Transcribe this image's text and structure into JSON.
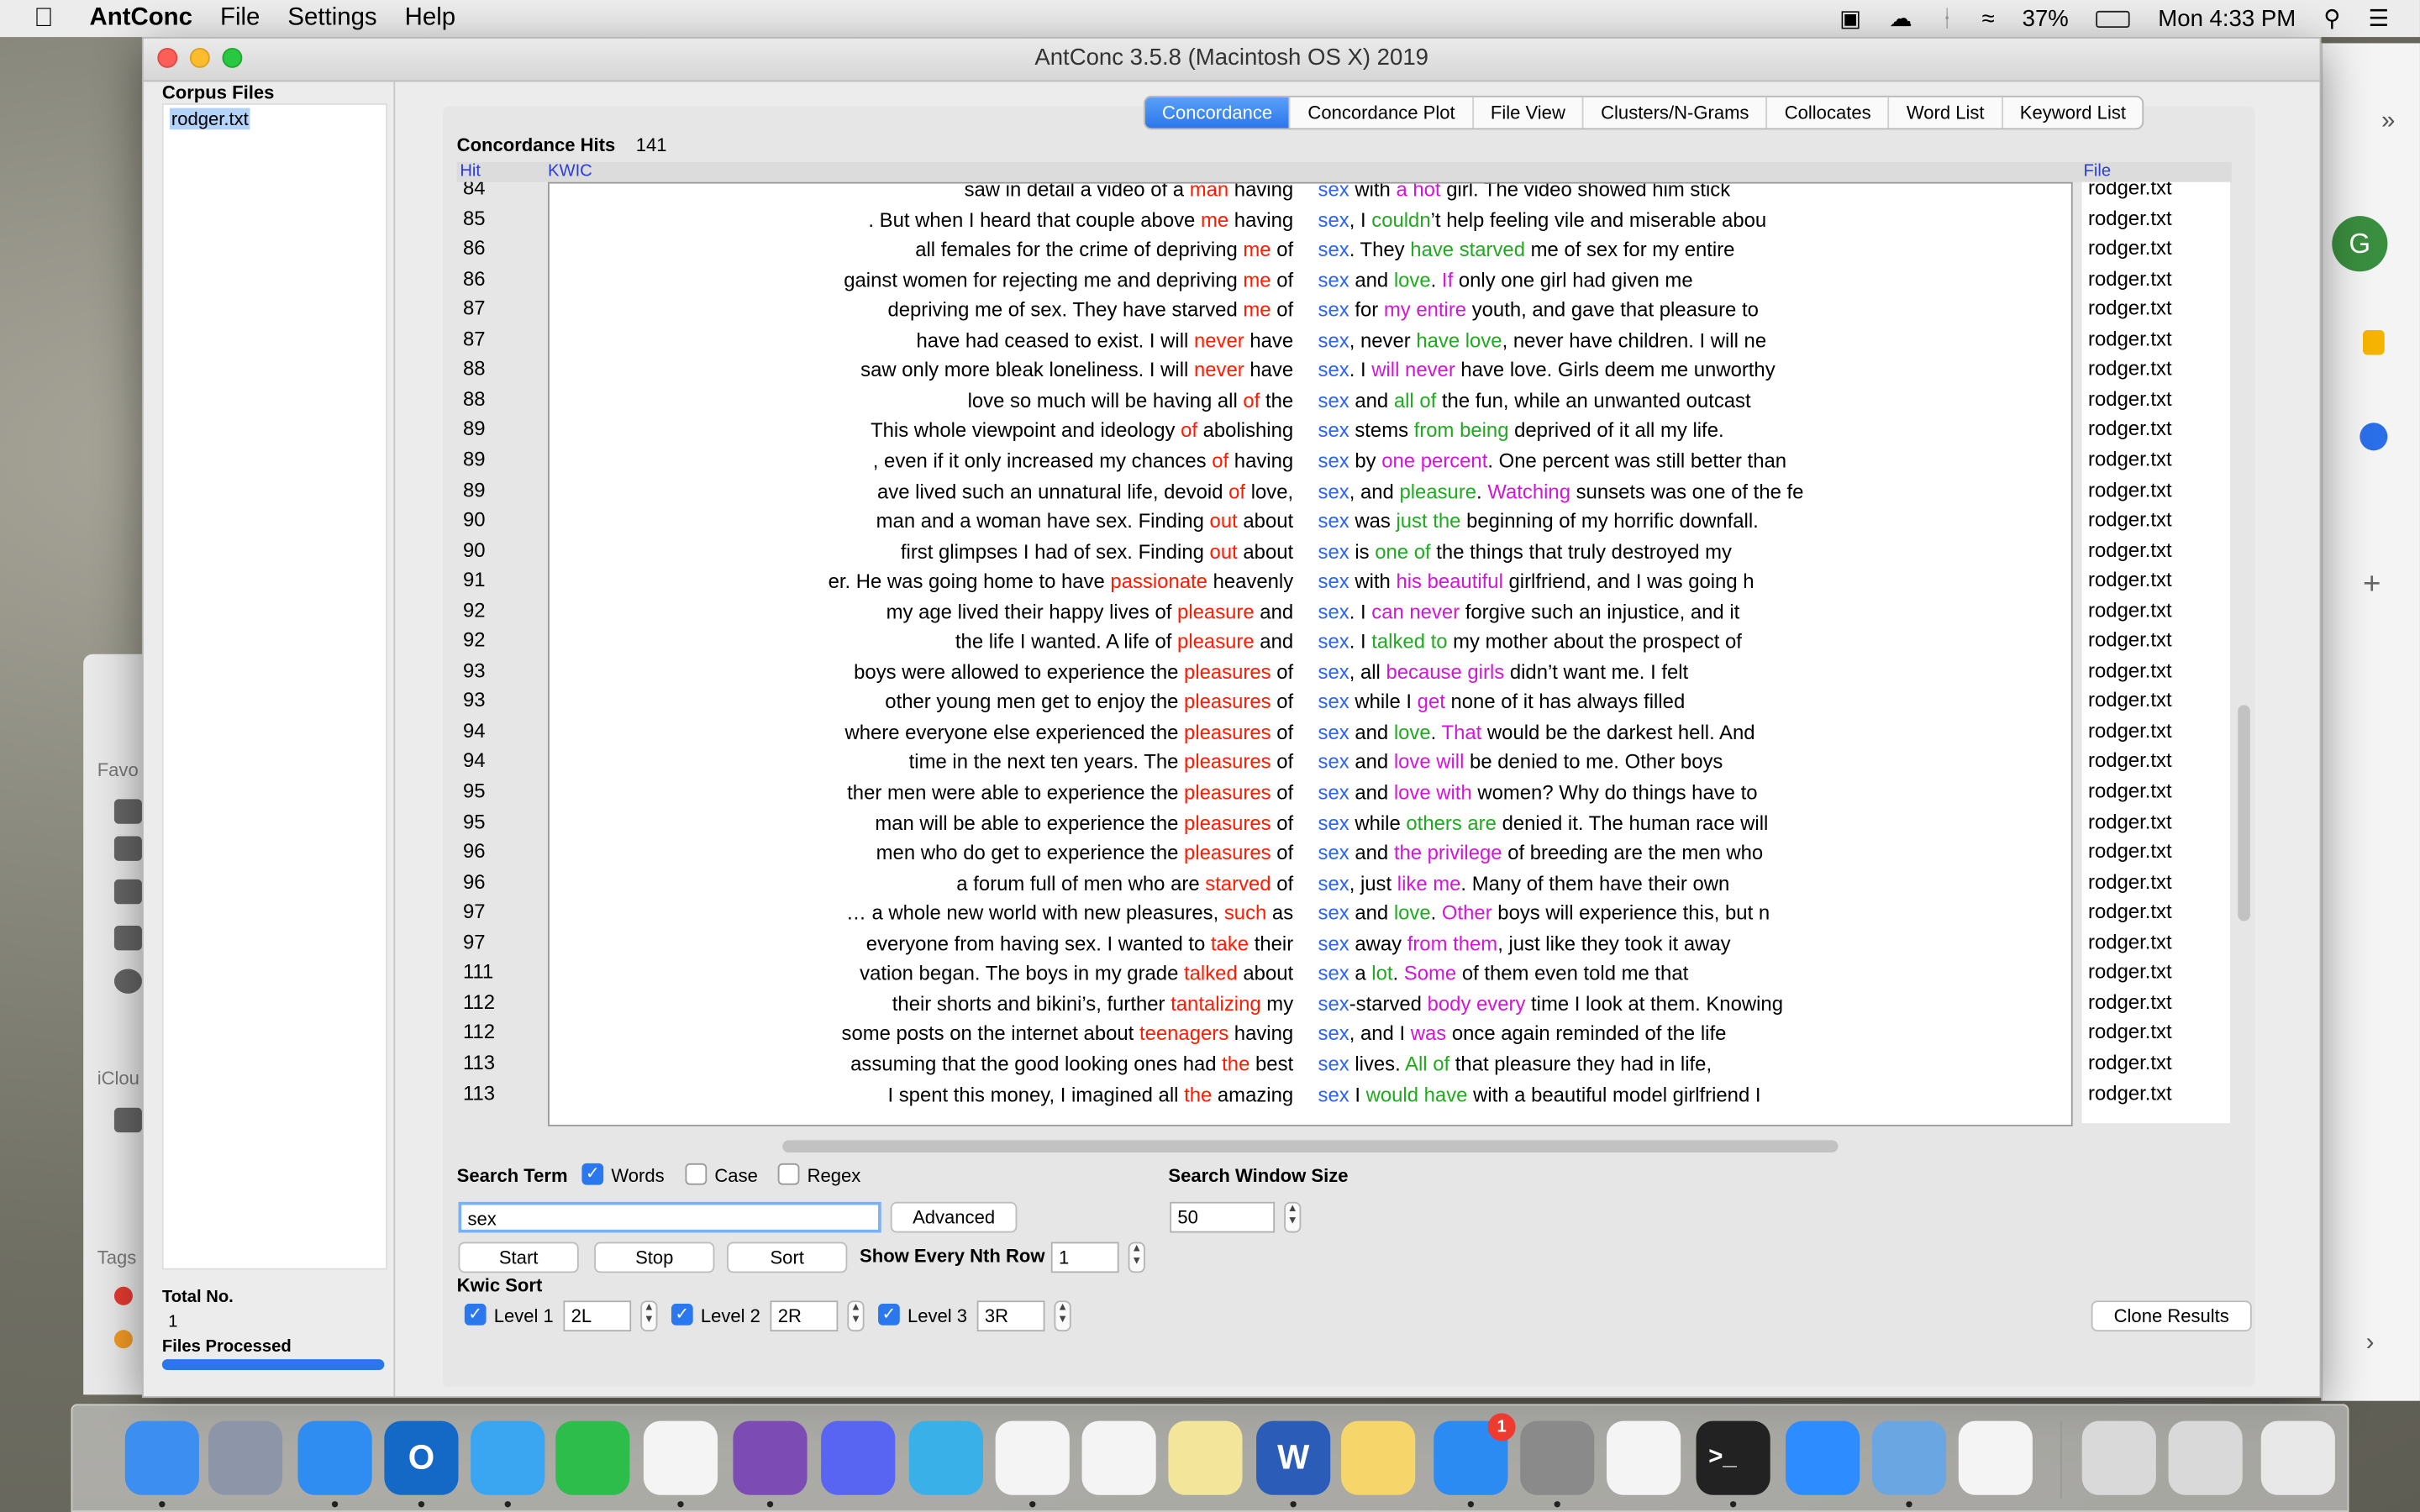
{
  "menubar": {
    "app": "AntConc",
    "menus": [
      "File",
      "Settings",
      "Help"
    ],
    "battery": "37%",
    "clock": "Mon 4:33 PM"
  },
  "window": {
    "title": "AntConc 3.5.8 (Macintosh OS X) 2019"
  },
  "corpus": {
    "header": "Corpus Files",
    "files": [
      "rodger.txt"
    ],
    "total_label": "Total No.",
    "total_value": "1",
    "processed_label": "Files Processed"
  },
  "tabs": [
    "Concordance",
    "Concordance Plot",
    "File View",
    "Clusters/N-Grams",
    "Collocates",
    "Word List",
    "Keyword List"
  ],
  "hits": {
    "label": "Concordance Hits",
    "value": "141"
  },
  "columns": {
    "hit": "Hit",
    "kwic": "KWIC",
    "file": "File"
  },
  "rows": [
    {
      "hit": "84",
      "file": "rodger.txt",
      "l": [
        [
          "saw in  detail a video of a ",
          ""
        ],
        [
          "man",
          "r"
        ],
        [
          " having",
          ""
        ]
      ],
      "r": [
        [
          "sex",
          "kw"
        ],
        [
          " with ",
          ""
        ],
        [
          "a hot",
          "m"
        ],
        [
          " girl. The video showed him stick",
          ""
        ]
      ]
    },
    {
      "hit": "85",
      "file": "rodger.txt",
      "l": [
        [
          ". But when I heard that couple above ",
          ""
        ],
        [
          "me",
          "r"
        ],
        [
          " having",
          ""
        ]
      ],
      "r": [
        [
          "sex",
          "kw"
        ],
        [
          ", I ",
          ""
        ],
        [
          "couldn",
          "g"
        ],
        [
          "’t help feeling vile and  miserable abou",
          ""
        ]
      ]
    },
    {
      "hit": "86",
      "file": "rodger.txt",
      "l": [
        [
          "all females for the crime of depriving  ",
          ""
        ],
        [
          "me",
          "r"
        ],
        [
          " of",
          ""
        ]
      ],
      "r": [
        [
          "sex",
          "kw"
        ],
        [
          ". They ",
          ""
        ],
        [
          "have starved",
          "g"
        ],
        [
          " me of sex for my entire",
          ""
        ]
      ]
    },
    {
      "hit": "86",
      "file": "rodger.txt",
      "l": [
        [
          "gainst women for rejecting me and depriving ",
          ""
        ],
        [
          "me",
          "r"
        ],
        [
          " of",
          ""
        ]
      ],
      "r": [
        [
          "sex",
          "kw"
        ],
        [
          " and  ",
          ""
        ],
        [
          "love",
          "g"
        ],
        [
          ". ",
          ""
        ],
        [
          "If",
          "m"
        ],
        [
          " only one girl had given me",
          ""
        ]
      ]
    },
    {
      "hit": "87",
      "file": "rodger.txt",
      "l": [
        [
          "depriving  me of sex. They have starved ",
          ""
        ],
        [
          "me",
          "r"
        ],
        [
          " of",
          ""
        ]
      ],
      "r": [
        [
          "sex",
          "kw"
        ],
        [
          " for ",
          ""
        ],
        [
          "my entire",
          "m"
        ],
        [
          " youth, and gave that pleasure to",
          ""
        ]
      ]
    },
    {
      "hit": "87",
      "file": "rodger.txt",
      "l": [
        [
          "have had ceased to exist. I will ",
          ""
        ],
        [
          "never",
          "r"
        ],
        [
          " have",
          ""
        ]
      ],
      "r": [
        [
          "sex",
          "kw"
        ],
        [
          ", never ",
          ""
        ],
        [
          "have love",
          "g"
        ],
        [
          ", never have children. I  will ne",
          ""
        ]
      ]
    },
    {
      "hit": "88",
      "file": "rodger.txt",
      "l": [
        [
          "saw only more bleak loneliness. I will ",
          ""
        ],
        [
          "never",
          "r"
        ],
        [
          " have",
          ""
        ]
      ],
      "r": [
        [
          "sex",
          "kw"
        ],
        [
          ". I ",
          ""
        ],
        [
          "will never",
          "m"
        ],
        [
          " have love. Girls deem  me unworthy",
          ""
        ]
      ]
    },
    {
      "hit": "88",
      "file": "rodger.txt",
      "l": [
        [
          "love so much will be having all ",
          ""
        ],
        [
          "of",
          "r"
        ],
        [
          " the",
          ""
        ]
      ],
      "r": [
        [
          "sex",
          "kw"
        ],
        [
          " and  ",
          ""
        ],
        [
          "all of",
          "g"
        ],
        [
          " the fun, while an unwanted outcast",
          ""
        ]
      ]
    },
    {
      "hit": "89",
      "file": "rodger.txt",
      "l": [
        [
          "This whole viewpoint and  ideology ",
          ""
        ],
        [
          "of",
          "r"
        ],
        [
          " abolishing",
          ""
        ]
      ],
      "r": [
        [
          "sex",
          "kw"
        ],
        [
          " stems ",
          ""
        ],
        [
          "from being",
          "g"
        ],
        [
          " deprived of it all my life.",
          ""
        ]
      ]
    },
    {
      "hit": "89",
      "file": "rodger.txt",
      "l": [
        [
          ", even if it  only increased my chances ",
          ""
        ],
        [
          "of",
          "r"
        ],
        [
          " having",
          ""
        ]
      ],
      "r": [
        [
          "sex",
          "kw"
        ],
        [
          " by ",
          ""
        ],
        [
          "one percent",
          "m"
        ],
        [
          ". One percent was still better than",
          ""
        ]
      ]
    },
    {
      "hit": "89",
      "file": "rodger.txt",
      "l": [
        [
          "ave lived such an unnatural life, devoid ",
          ""
        ],
        [
          "of",
          "r"
        ],
        [
          " love,",
          ""
        ]
      ],
      "r": [
        [
          "sex",
          "kw"
        ],
        [
          ", and ",
          ""
        ],
        [
          "pleasure",
          "g"
        ],
        [
          ". ",
          ""
        ],
        [
          "Watching",
          "m"
        ],
        [
          " sunsets was one of the fe",
          ""
        ]
      ]
    },
    {
      "hit": "90",
      "file": "rodger.txt",
      "l": [
        [
          "man and a woman have sex. Finding ",
          ""
        ],
        [
          "out",
          "r"
        ],
        [
          " about",
          ""
        ]
      ],
      "r": [
        [
          "sex",
          "kw"
        ],
        [
          " was ",
          ""
        ],
        [
          "just the",
          "g"
        ],
        [
          "  beginning of my horrific downfall.",
          ""
        ]
      ]
    },
    {
      "hit": "90",
      "file": "rodger.txt",
      "l": [
        [
          "first glimpses I had of sex. Finding ",
          ""
        ],
        [
          "out",
          "r"
        ],
        [
          " about",
          ""
        ]
      ],
      "r": [
        [
          "sex",
          "kw"
        ],
        [
          " is ",
          ""
        ],
        [
          "one of",
          "g"
        ],
        [
          " the things that  truly destroyed my",
          ""
        ]
      ]
    },
    {
      "hit": "91",
      "file": "rodger.txt",
      "l": [
        [
          "er. He was going home to have ",
          ""
        ],
        [
          "passionate",
          "r"
        ],
        [
          " heavenly",
          ""
        ]
      ],
      "r": [
        [
          "sex",
          "kw"
        ],
        [
          " with ",
          ""
        ],
        [
          "his beautiful",
          "m"
        ],
        [
          " girlfriend, and I  was going h",
          ""
        ]
      ]
    },
    {
      "hit": "92",
      "file": "rodger.txt",
      "l": [
        [
          "my age lived their  happy lives of ",
          ""
        ],
        [
          "pleasure",
          "r"
        ],
        [
          " and",
          ""
        ]
      ],
      "r": [
        [
          "sex",
          "kw"
        ],
        [
          ". I ",
          ""
        ],
        [
          "can never",
          "m"
        ],
        [
          " forgive such an injustice, and it",
          ""
        ]
      ]
    },
    {
      "hit": "92",
      "file": "rodger.txt",
      "l": [
        [
          "the life I wanted. A life of ",
          ""
        ],
        [
          "pleasure",
          "r"
        ],
        [
          " and",
          ""
        ]
      ],
      "r": [
        [
          "sex",
          "kw"
        ],
        [
          ". I ",
          ""
        ],
        [
          "talked to",
          "g"
        ],
        [
          " my mother about the  prospect of",
          ""
        ]
      ]
    },
    {
      "hit": "93",
      "file": "rodger.txt",
      "l": [
        [
          "boys were allowed to experience  the ",
          ""
        ],
        [
          "pleasures",
          "r"
        ],
        [
          " of",
          ""
        ]
      ],
      "r": [
        [
          "sex",
          "kw"
        ],
        [
          ", all ",
          ""
        ],
        [
          "because girls",
          "m"
        ],
        [
          " didn’t want me. I felt",
          ""
        ]
      ]
    },
    {
      "hit": "93",
      "file": "rodger.txt",
      "l": [
        [
          "other young men get to enjoy the ",
          ""
        ],
        [
          "pleasures",
          "r"
        ],
        [
          " of",
          ""
        ]
      ],
      "r": [
        [
          "sex",
          "kw"
        ],
        [
          " while I ",
          ""
        ],
        [
          "get",
          "m"
        ],
        [
          " none of it has always filled",
          ""
        ]
      ]
    },
    {
      "hit": "94",
      "file": "rodger.txt",
      "l": [
        [
          "where everyone else experienced the ",
          ""
        ],
        [
          "pleasures",
          "r"
        ],
        [
          " of ",
          ""
        ]
      ],
      "r": [
        [
          "sex",
          "kw"
        ],
        [
          " and ",
          ""
        ],
        [
          "love",
          "g"
        ],
        [
          ". ",
          ""
        ],
        [
          "That",
          "m"
        ],
        [
          " would be the darkest hell. And",
          ""
        ]
      ]
    },
    {
      "hit": "94",
      "file": "rodger.txt",
      "l": [
        [
          "time in the next ten years. The ",
          ""
        ],
        [
          "pleasures",
          "r"
        ],
        [
          " of",
          ""
        ]
      ],
      "r": [
        [
          "sex",
          "kw"
        ],
        [
          " and ",
          ""
        ],
        [
          "love will",
          "m"
        ],
        [
          " be denied to me. Other boys",
          ""
        ]
      ]
    },
    {
      "hit": "95",
      "file": "rodger.txt",
      "l": [
        [
          "ther men were able to experience the ",
          ""
        ],
        [
          "pleasures",
          "r"
        ],
        [
          " of",
          ""
        ]
      ],
      "r": [
        [
          "sex",
          "kw"
        ],
        [
          " and ",
          ""
        ],
        [
          "love with",
          "m"
        ],
        [
          " women?  Why do things have to",
          ""
        ]
      ]
    },
    {
      "hit": "95",
      "file": "rodger.txt",
      "l": [
        [
          "man will be able to  experience the ",
          ""
        ],
        [
          "pleasures",
          "r"
        ],
        [
          " of",
          ""
        ]
      ],
      "r": [
        [
          "sex",
          "kw"
        ],
        [
          " while ",
          ""
        ],
        [
          "others are",
          "g"
        ],
        [
          " denied it. The human race will",
          ""
        ]
      ]
    },
    {
      "hit": "96",
      "file": "rodger.txt",
      "l": [
        [
          "men who do get to experience the ",
          ""
        ],
        [
          "pleasures",
          "r"
        ],
        [
          " of",
          ""
        ]
      ],
      "r": [
        [
          "sex",
          "kw"
        ],
        [
          " and ",
          ""
        ],
        [
          "the  privilege",
          "m"
        ],
        [
          " of breeding are the men who",
          ""
        ]
      ]
    },
    {
      "hit": "96",
      "file": "rodger.txt",
      "l": [
        [
          "a forum full  of men who are ",
          ""
        ],
        [
          "starved",
          "r"
        ],
        [
          " of",
          ""
        ]
      ],
      "r": [
        [
          "sex",
          "kw"
        ],
        [
          ", just ",
          ""
        ],
        [
          "like me",
          "m"
        ],
        [
          ". Many of them have their own",
          ""
        ]
      ]
    },
    {
      "hit": "97",
      "file": "rodger.txt",
      "l": [
        [
          "… a whole new world with new pleasures, ",
          ""
        ],
        [
          "such",
          "r"
        ],
        [
          " as",
          ""
        ]
      ],
      "r": [
        [
          "sex",
          "kw"
        ],
        [
          " and ",
          ""
        ],
        [
          "love",
          "g"
        ],
        [
          ". ",
          ""
        ],
        [
          "Other",
          "m"
        ],
        [
          " boys will  experience this, but n",
          ""
        ]
      ]
    },
    {
      "hit": "97",
      "file": "rodger.txt",
      "l": [
        [
          "everyone from having sex. I  wanted to ",
          ""
        ],
        [
          "take",
          "r"
        ],
        [
          " their",
          ""
        ]
      ],
      "r": [
        [
          "sex",
          "kw"
        ],
        [
          " away ",
          ""
        ],
        [
          "from them",
          "m"
        ],
        [
          ", just like they took it away",
          ""
        ]
      ]
    },
    {
      "hit": "111",
      "file": "rodger.txt",
      "l": [
        [
          "vation began.   The boys in my grade ",
          ""
        ],
        [
          "talked",
          "r"
        ],
        [
          " about",
          ""
        ]
      ],
      "r": [
        [
          "sex",
          "kw"
        ],
        [
          " a ",
          ""
        ],
        [
          "lot",
          "g"
        ],
        [
          ". ",
          ""
        ],
        [
          "Some",
          "m"
        ],
        [
          " of them even told me that",
          ""
        ]
      ]
    },
    {
      "hit": "112",
      "file": "rodger.txt",
      "l": [
        [
          "their shorts and bikini’s, further ",
          ""
        ],
        [
          "tantalizing",
          "r"
        ],
        [
          " my",
          ""
        ]
      ],
      "r": [
        [
          "sex",
          "kw"
        ],
        [
          "-starved ",
          ""
        ],
        [
          "body every",
          "m"
        ],
        [
          " time I look at  them. Knowing",
          ""
        ]
      ]
    },
    {
      "hit": "112",
      "file": "rodger.txt",
      "l": [
        [
          "some posts on the internet about ",
          ""
        ],
        [
          "teenagers",
          "r"
        ],
        [
          " having",
          ""
        ]
      ],
      "r": [
        [
          "sex",
          "kw"
        ],
        [
          ", and I ",
          ""
        ],
        [
          "was",
          "m"
        ],
        [
          " once again  reminded of the life",
          ""
        ]
      ]
    },
    {
      "hit": "113",
      "file": "rodger.txt",
      "l": [
        [
          "assuming that the good looking ones had ",
          ""
        ],
        [
          "the",
          "r"
        ],
        [
          " best",
          ""
        ]
      ],
      "r": [
        [
          "sex",
          "kw"
        ],
        [
          " lives. ",
          ""
        ],
        [
          "All of",
          "g"
        ],
        [
          " that pleasure  they had in life,",
          ""
        ]
      ]
    },
    {
      "hit": "113",
      "file": "rodger.txt",
      "l": [
        [
          "I spent this money, I imagined all ",
          ""
        ],
        [
          "the",
          "r"
        ],
        [
          " amazing",
          ""
        ]
      ],
      "r": [
        [
          "sex",
          "kw"
        ],
        [
          " I ",
          ""
        ],
        [
          "would have",
          "g"
        ],
        [
          " with a beautiful model girlfriend I",
          ""
        ]
      ]
    }
  ],
  "search": {
    "term_label": "Search Term",
    "words": "Words",
    "case": "Case",
    "regex": "Regex",
    "value": "sex",
    "advanced": "Advanced",
    "window_label": "Search Window Size",
    "window_value": "50",
    "start": "Start",
    "stop": "Stop",
    "sort": "Sort",
    "nth_label": "Show Every Nth Row",
    "nth_value": "1"
  },
  "kwic": {
    "label": "Kwic Sort",
    "level1": "Level 1",
    "l1": "2L",
    "level2": "Level 2",
    "l2": "2R",
    "level3": "Level 3",
    "l3": "3R"
  },
  "clone": "Clone Results",
  "side": {
    "favorites": "Favo",
    "icloud": "iClou",
    "tags": "Tags",
    "avatar": "G"
  },
  "colors": {
    "keyword": "#2c64f0",
    "red": "#ff1a00",
    "green": "#1faa1f",
    "magenta": "#d216d8",
    "accent": "#2a76ee"
  },
  "dock": [
    "finder",
    "launchpad",
    "safari",
    "outlook",
    "messages",
    "facetime",
    "slack",
    "github-desktop",
    "discord",
    "markdown",
    "photos",
    "reminders",
    "stickies",
    "word",
    "notes",
    "app-store",
    "system-preferences",
    "music",
    "terminal",
    "zoom",
    "antconc",
    "textedit",
    "downloads",
    "documents",
    "trash"
  ],
  "badge": "1"
}
